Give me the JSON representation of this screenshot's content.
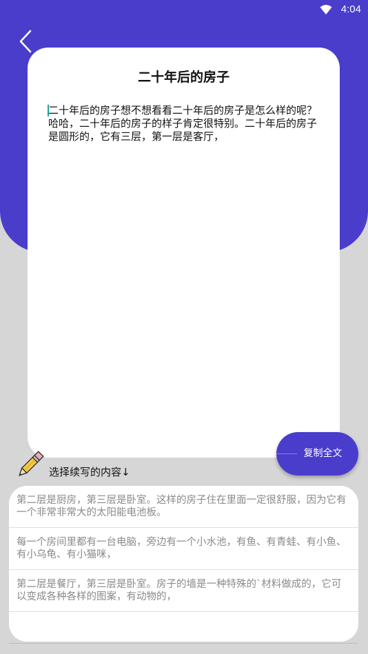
{
  "status_bar": {
    "time": "4:04",
    "icon": "wifi-icon"
  },
  "header": {
    "back_icon": "chevron-left-icon"
  },
  "card": {
    "title": "二十年后的房子",
    "body": "二十年后的房子想不想看看二十年后的房子是怎么样的呢？哈哈，二十年后的房子的样子肯定很特别。二十年后的房子是圆形的，它有三层，第一层是客厅，"
  },
  "copy_button": {
    "label": "复制全文"
  },
  "continuation": {
    "label": "选择续写的内容↓",
    "icon": "pencil-icon",
    "options": [
      "第二层是厨房，第三层是卧室。这样的房子住在里面一定很舒服，因为它有一个非常非常大的太阳能电池板。",
      "每一个房间里都有一台电脑，旁边有一个小水池，有鱼、有青蛙、有小鱼、有小乌龟、有小猫咪，",
      "第二层是餐厅，第三层是卧室。房子的墙是一种特殊的`材料做成的，它可以变成各种各样的图案，有动物的，"
    ]
  },
  "colors": {
    "accent": "#4a3dcc",
    "background": "#d6d6d6",
    "card": "#ffffff",
    "option_text": "#8a8a8a",
    "caret": "#19a394"
  }
}
